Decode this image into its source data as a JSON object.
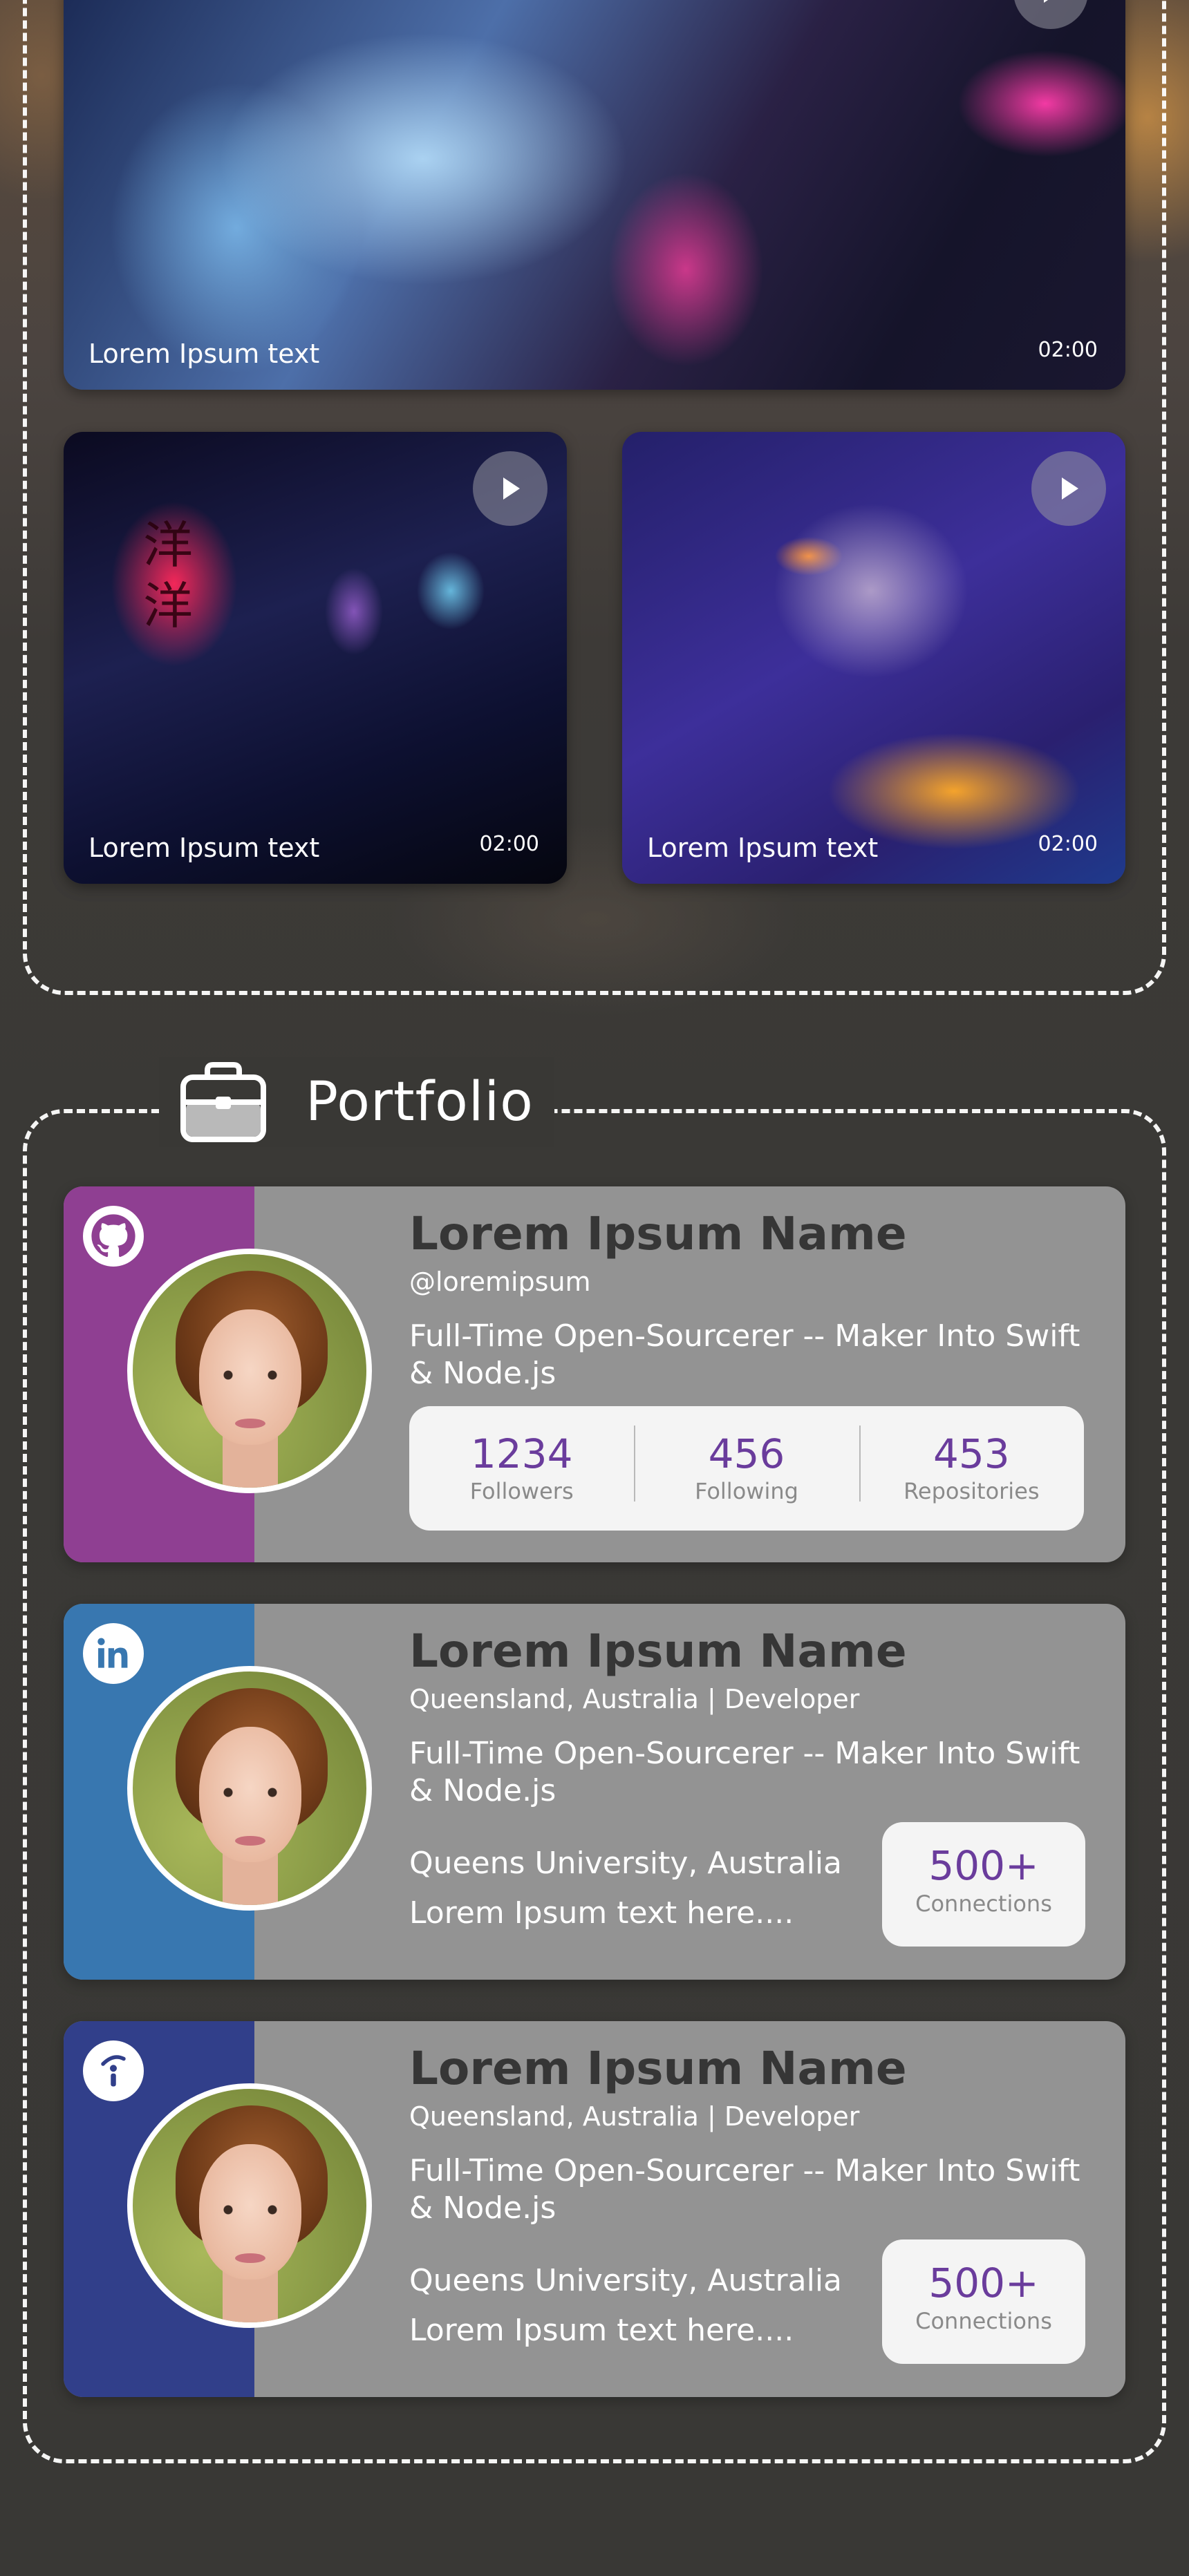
{
  "colors": {
    "github_band": "#8f3f92",
    "linkedin_band": "#3877b0",
    "indeed_band": "#313f8a",
    "card_bg": "#939393",
    "accent_number": "#6a3c9c"
  },
  "videos": [
    {
      "caption": "Lorem Ipsum text",
      "duration": "02:00"
    },
    {
      "caption": "Lorem Ipsum text",
      "duration": "02:00"
    },
    {
      "caption": "Lorem Ipsum text",
      "duration": "02:00"
    }
  ],
  "video_decor": {
    "lantern_text": "洋\n洋"
  },
  "portfolio": {
    "title": "Portfolio",
    "icon": "briefcase-icon",
    "cards": [
      {
        "brand_icon": "github-icon",
        "name": "Lorem Ipsum Name",
        "handle": "@loremipsum",
        "bio": "Full-Time Open-Sourcerer -- Maker Into Swift & Node.js",
        "stats": [
          {
            "value": "1234",
            "label": "Followers"
          },
          {
            "value": "456",
            "label": "Following"
          },
          {
            "value": "453",
            "label": "Repositories"
          }
        ]
      },
      {
        "brand_icon": "linkedin-icon",
        "name": "Lorem Ipsum Name",
        "location": "Queensland, Australia | Developer",
        "bio": "Full-Time Open-Sourcerer -- Maker Into Swift & Node.js",
        "education": "Queens University, Australia",
        "extra": "Lorem Ipsum text here....",
        "connections_value": "500+",
        "connections_label": "Connections"
      },
      {
        "brand_icon": "indeed-icon",
        "name": "Lorem Ipsum Name",
        "location": "Queensland, Australia | Developer",
        "bio": "Full-Time Open-Sourcerer -- Maker Into Swift & Node.js",
        "education": "Queens University, Australia",
        "extra": "Lorem Ipsum text here....",
        "connections_value": "500+",
        "connections_label": "Connections"
      }
    ]
  }
}
